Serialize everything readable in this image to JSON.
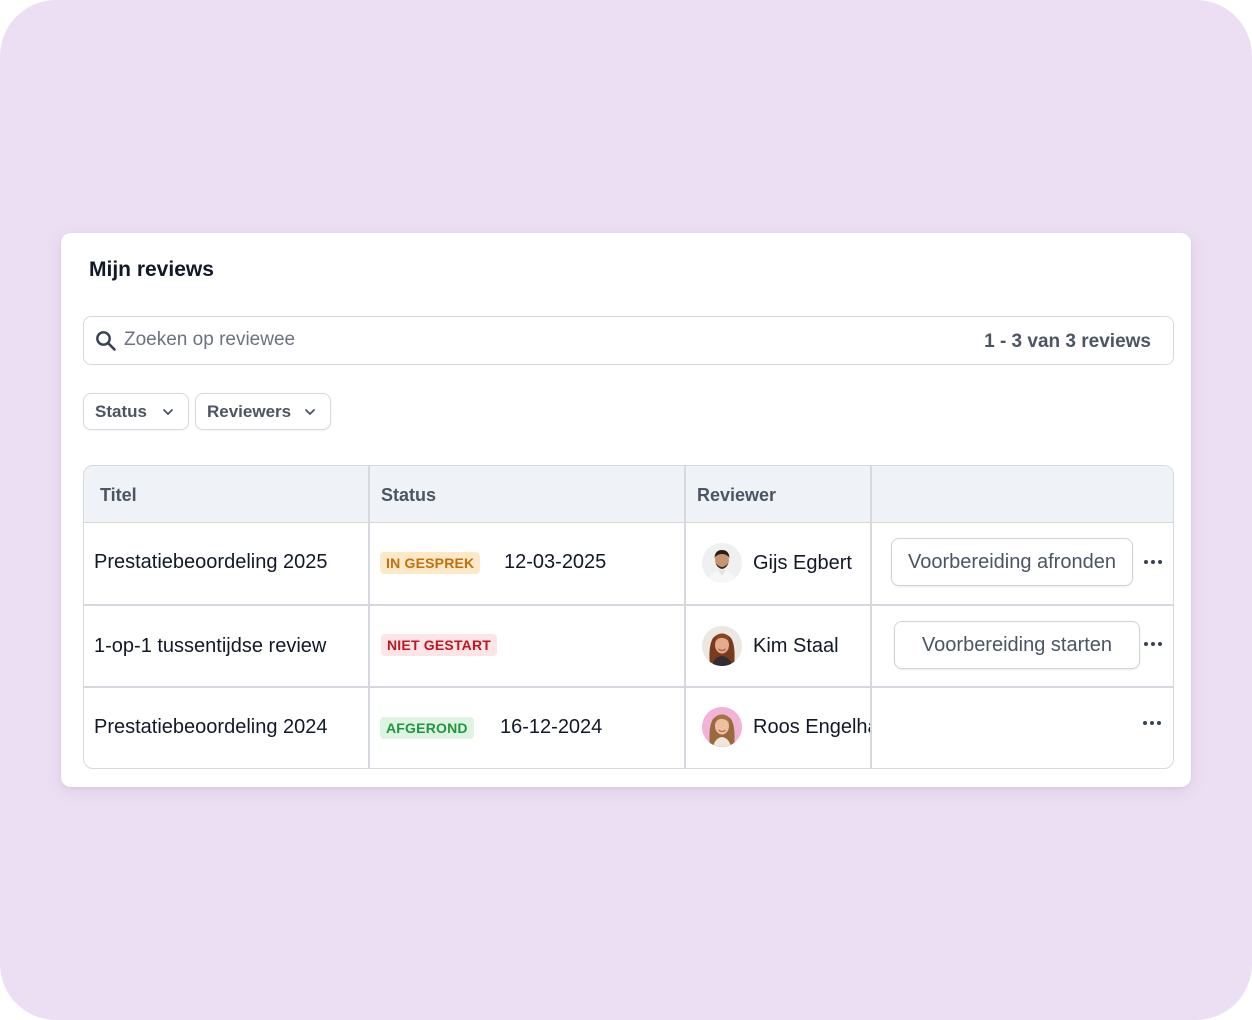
{
  "card": {
    "title": "Mijn reviews"
  },
  "search": {
    "placeholder": "Zoeken op reviewee",
    "value": "",
    "result_count": "1 - 3 van 3 reviews"
  },
  "filters": [
    {
      "label": "Status"
    },
    {
      "label": "Reviewers"
    }
  ],
  "table": {
    "headers": [
      "Titel",
      "Status",
      "Reviewer",
      ""
    ],
    "rows": [
      {
        "title": "Prestatiebeoordeling 2025",
        "status": "IN GESPREK",
        "date": "12-03-2025",
        "reviewer": "Gijs Egbert",
        "action": "Voorbereiding afronden"
      },
      {
        "title": "1-op-1 tussentijdse review",
        "status": "NIET GESTART",
        "date": "",
        "reviewer": "Kim Staal",
        "action": "Voorbereiding starten"
      },
      {
        "title": "Prestatiebeoordeling 2024",
        "status": "AFGEROND",
        "date": "16-12-2024",
        "reviewer": "Roos Engelha",
        "action": ""
      }
    ]
  },
  "icons": {
    "search": "search-icon",
    "chevron": "chevron-down-icon",
    "more": "more-horizontal-icon"
  },
  "colors": {
    "background": "#ecdff3",
    "badge_in_gesprek_bg": "#fde9c8",
    "badge_in_gesprek_fg": "#c0700e",
    "badge_niet_gestart_bg": "#fde4e6",
    "badge_niet_gestart_fg": "#c01622",
    "badge_afgerond_bg": "#dcf4e1",
    "badge_afgerond_fg": "#21963c"
  }
}
